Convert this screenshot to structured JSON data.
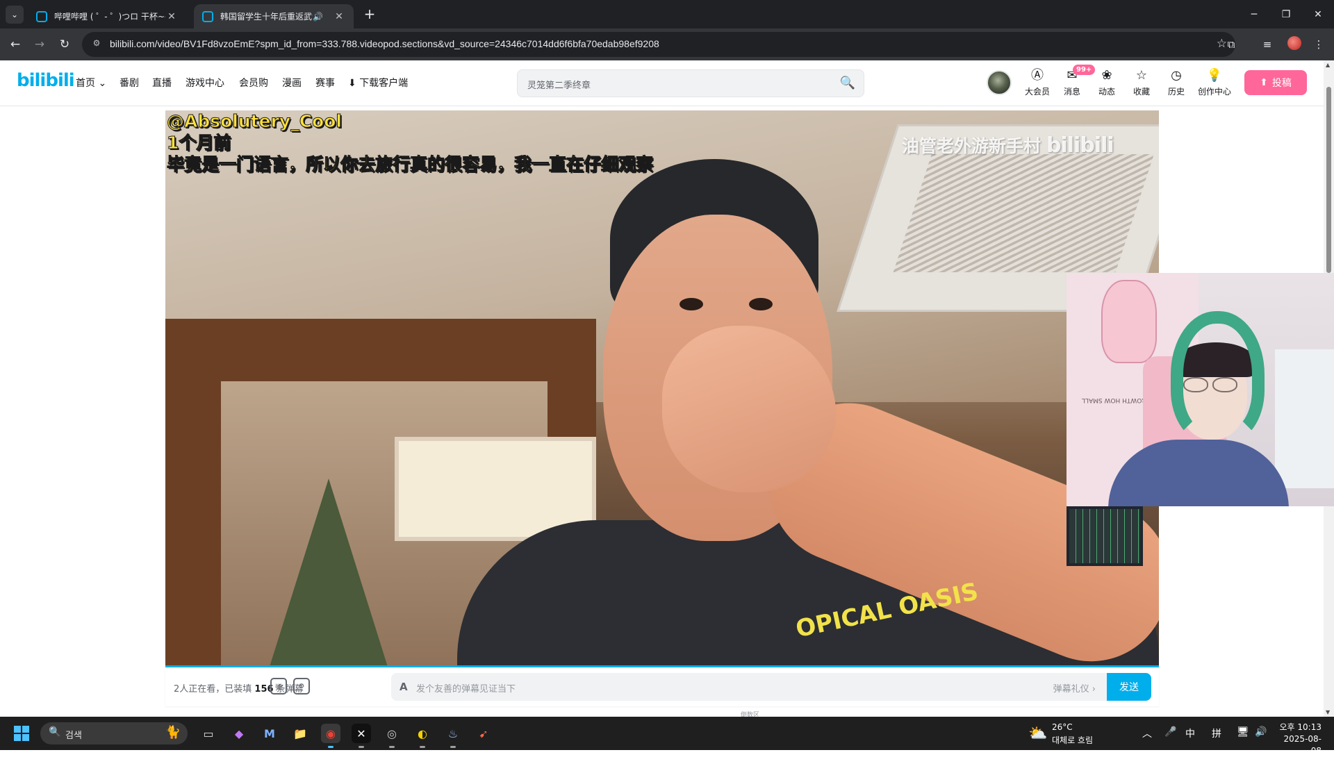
{
  "browser": {
    "tabs": [
      {
        "title": "哔哩哔哩 ( ゜- ゜)つロ 干杯~-bi",
        "close": "✕"
      },
      {
        "title": "韩国留学生十年后重返武汉",
        "audio": "🔊",
        "close": "✕"
      }
    ],
    "tab_list": "⌄",
    "new_tab": "+",
    "window_controls": {
      "minimize": "─",
      "restore": "❐",
      "close": "✕"
    },
    "nav": {
      "back": "←",
      "forward": "→",
      "reload": "↻"
    },
    "url": "bilibili.com/video/BV1Fd8vzoEmE?spm_id_from=333.788.videopod.sections&vd_source=24346c7014dd6f6bfa70edab98ef9208",
    "site_info_icon": "⚙",
    "bookmark_icon": "☆",
    "extensions_icon": "⧉",
    "media_icon": "≡",
    "menu_icon": "⋮"
  },
  "header": {
    "logo": "bilibili",
    "nav": [
      "首页",
      "番剧",
      "直播",
      "游戏中心",
      "会员购",
      "漫画",
      "赛事",
      "下载客户端"
    ],
    "home_caret": "⌄",
    "download_icon": "⬇",
    "search_placeholder": "灵笼第二季终章",
    "search_icon": "🔍",
    "entries": [
      {
        "icon": "Ⓐ",
        "label": "大会员"
      },
      {
        "icon": "✉",
        "label": "消息"
      },
      {
        "icon": "❀",
        "label": "动态"
      },
      {
        "icon": "☆",
        "label": "收藏"
      },
      {
        "icon": "◷",
        "label": "历史"
      },
      {
        "icon": "💡",
        "label": "创作中心"
      }
    ],
    "message_badge": "99+",
    "upload_label": "投稿",
    "upload_icon": "⬆"
  },
  "video": {
    "subtitle_lines": [
      "@Absolutery_Cool",
      "1个月前",
      "毕竟是一门语言，所以你去旅行真的很容易，我一直在仔细观察"
    ],
    "watermark": "油管老外游新手村",
    "watermark_logo": "bilibili",
    "shirt_text": "OPICAL OASIS",
    "poster_text": "S GROWTH  HOW SMALL"
  },
  "danmaku": {
    "stats_prefix": "2人正在看，已装填 ",
    "stats_count": "156",
    "stats_suffix": " 条弹幕",
    "toggle_icon_1": "弹",
    "toggle_icon_2": "⚙",
    "input_icon": "A",
    "placeholder": "发个友善的弹幕见证当下",
    "etiquette": "弹幕礼仪 ›",
    "send": "发送",
    "below_hint": "倒数区"
  },
  "taskbar": {
    "search_label": "검색",
    "search_icon": "🔍",
    "search_deco": "🐈",
    "apps": [
      "▭",
      "◆",
      "M",
      "📁",
      "◉",
      "✕",
      "◎",
      "◐",
      "♨",
      "➹"
    ],
    "weather_icon": "⛅",
    "weather_temp": "26°C",
    "weather_desc": "대체로 흐림",
    "tray": [
      "︿",
      "🎤",
      "中",
      "拼",
      "🖥",
      "🔊"
    ],
    "time": "오후 10:13",
    "date": "2025-08-08"
  },
  "colors": {
    "bili_blue": "#00aeec",
    "bili_pink": "#ff6699",
    "subtitle_yellow": "#ffe23a"
  }
}
